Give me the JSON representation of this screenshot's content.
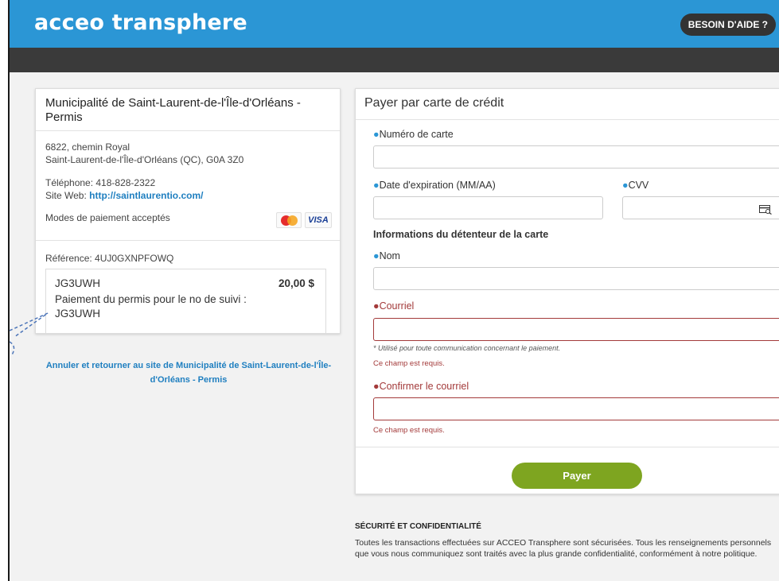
{
  "header": {
    "logo": "acceo transphere",
    "help_button": "BESOIN D'AIDE ?"
  },
  "merchant": {
    "name": "Municipalité de Saint-Laurent-de-l'Île-d'Orléans - Permis",
    "address_line1": "6822, chemin Royal",
    "address_line2": "Saint-Laurent-de-l'Île-d'Orléans (QC), G0A 3Z0",
    "phone": "Téléphone: 418-828-2322",
    "website_label": "Site Web: ",
    "website_url": "http://saintlaurentio.com/",
    "payment_methods_label": "Modes de paiement acceptés",
    "payment_methods": [
      "mastercard",
      "VISA"
    ],
    "reference": "Référence: 4UJ0GXNPFOWQ",
    "item": {
      "code": "JG3UWH",
      "amount": "20,00 $",
      "description": "Paiement du permis pour le no de suivi : JG3UWH"
    },
    "cancel_link": "Annuler et retourner au site de Municipalité de Saint-Laurent-de-l'Île-d'Orléans - Permis"
  },
  "payment_form": {
    "title": "Payer par carte de crédit",
    "card_number_label": "Numéro de carte",
    "card_number_value": "",
    "expiry_label": "Date d'expiration (MM/AA)",
    "expiry_value": "",
    "cvv_label": "CVV",
    "cvv_value": "",
    "holder_section": "Informations du détenteur de la carte",
    "name_label": "Nom",
    "name_value": "",
    "email_label": "Courriel",
    "email_value": "",
    "email_hint": "* Utilisé pour toute communication concernant le paiement.",
    "email_error": "Ce champ est requis.",
    "confirm_email_label": "Confirmer le courriel",
    "confirm_email_value": "",
    "confirm_email_error": "Ce champ est requis.",
    "pay_button": "Payer"
  },
  "security": {
    "title": "SÉCURITÉ ET CONFIDENTIALITÉ",
    "body": "Toutes les transactions effectuées sur ACCEO Transphere sont sécurisées. Tous les renseignements personnels que vous nous communiquez sont traités avec la plus grande confidentialité, conformément à notre politique."
  },
  "colors": {
    "brand_blue": "#2b96d5",
    "dark_bar": "#3a3a3a",
    "error_red": "#a33a3a",
    "pay_green": "#7ea520",
    "link_blue": "#1f7fc0"
  }
}
